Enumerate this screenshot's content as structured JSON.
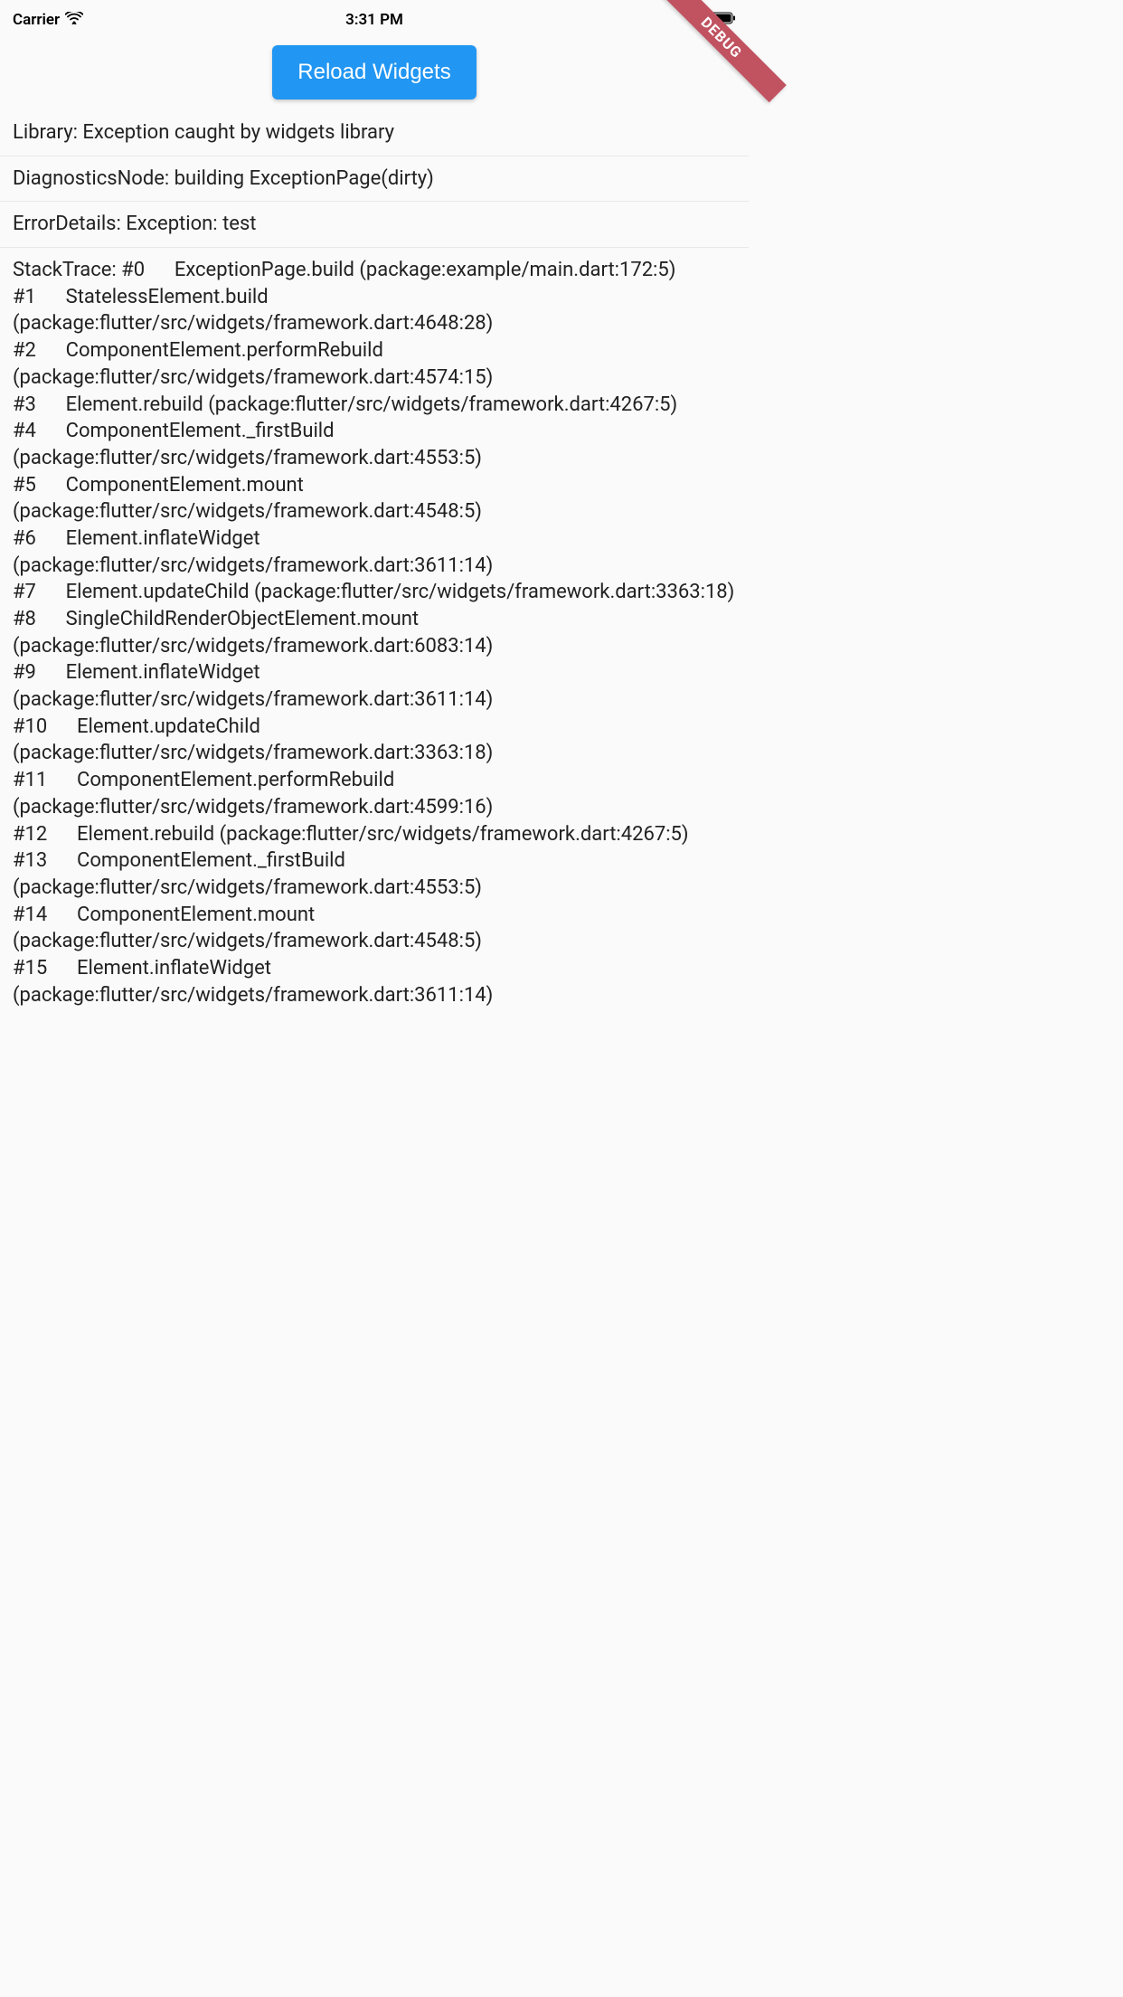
{
  "status_bar": {
    "carrier": "Carrier",
    "time": "3:31 PM"
  },
  "debug_banner": "DEBUG",
  "reload_button": {
    "label": "Reload Widgets"
  },
  "errors": {
    "library": "Library: Exception caught by widgets library",
    "diagnostics_node": "DiagnosticsNode: building ExceptionPage(dirty)",
    "error_details": "ErrorDetails: Exception: test",
    "stack_trace": "StackTrace: #0      ExceptionPage.build (package:example/main.dart:172:5)\n#1      StatelessElement.build (package:flutter/src/widgets/framework.dart:4648:28)\n#2      ComponentElement.performRebuild (package:flutter/src/widgets/framework.dart:4574:15)\n#3      Element.rebuild (package:flutter/src/widgets/framework.dart:4267:5)\n#4      ComponentElement._firstBuild (package:flutter/src/widgets/framework.dart:4553:5)\n#5      ComponentElement.mount (package:flutter/src/widgets/framework.dart:4548:5)\n#6      Element.inflateWidget (package:flutter/src/widgets/framework.dart:3611:14)\n#7      Element.updateChild (package:flutter/src/widgets/framework.dart:3363:18)\n#8      SingleChildRenderObjectElement.mount (package:flutter/src/widgets/framework.dart:6083:14)\n#9      Element.inflateWidget (package:flutter/src/widgets/framework.dart:3611:14)\n#10      Element.updateChild (package:flutter/src/widgets/framework.dart:3363:18)\n#11      ComponentElement.performRebuild (package:flutter/src/widgets/framework.dart:4599:16)\n#12      Element.rebuild (package:flutter/src/widgets/framework.dart:4267:5)\n#13      ComponentElement._firstBuild (package:flutter/src/widgets/framework.dart:4553:5)\n#14      ComponentElement.mount (package:flutter/src/widgets/framework.dart:4548:5)\n#15      Element.inflateWidget (package:flutter/src/widgets/framework.dart:3611:14)"
  }
}
